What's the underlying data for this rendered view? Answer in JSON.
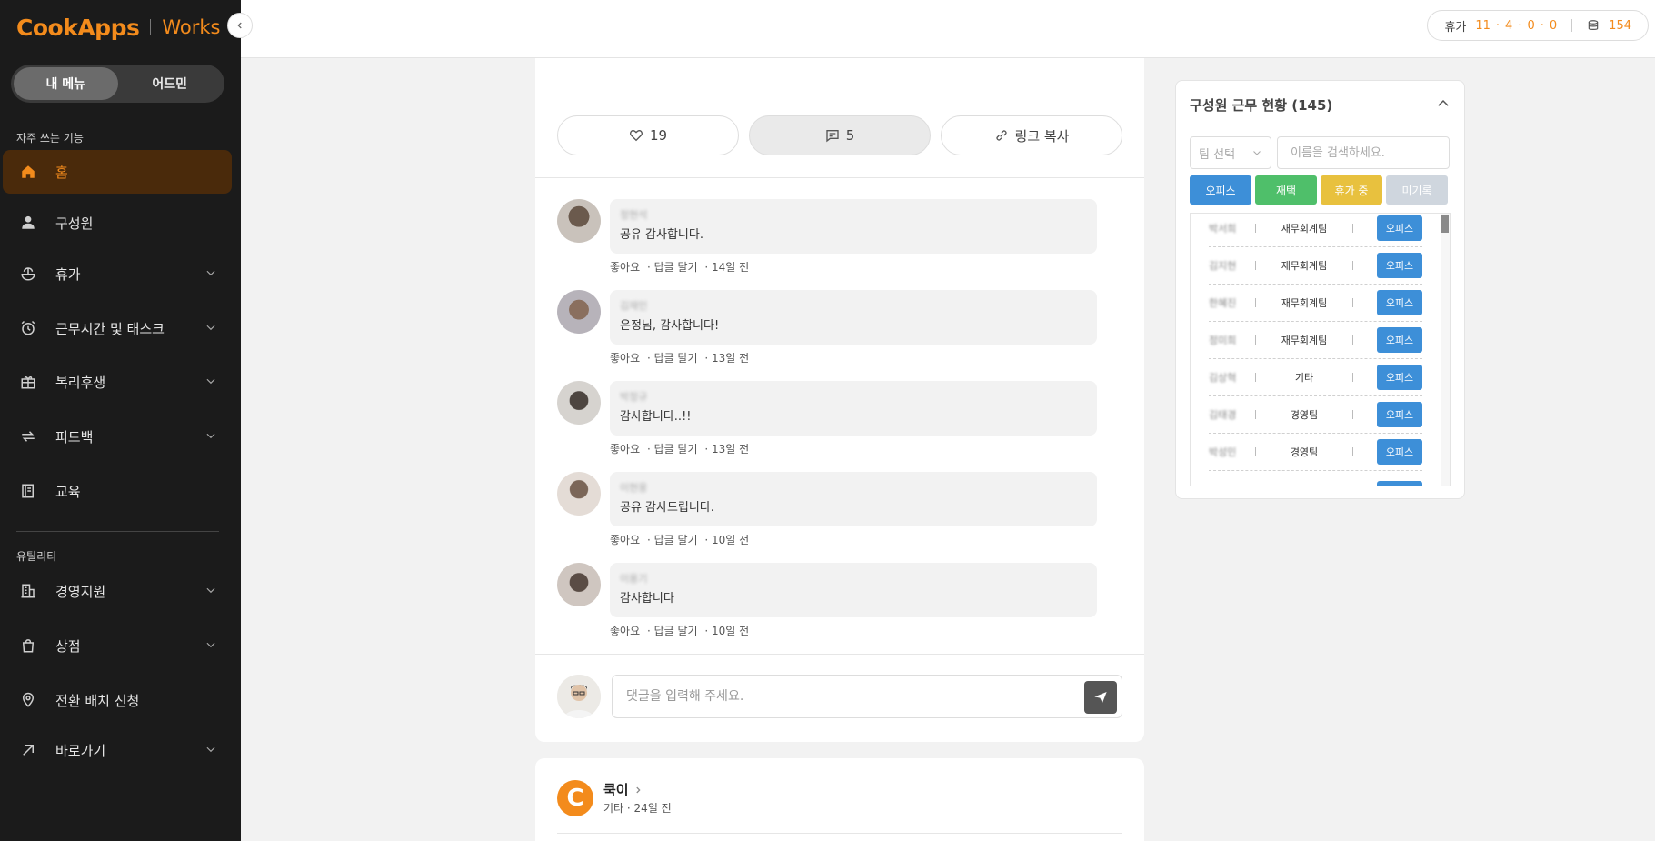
{
  "brand": {
    "name": "CookApps",
    "product": "Works"
  },
  "sidebar": {
    "tabs": [
      {
        "label": "내 메뉴"
      },
      {
        "label": "어드민"
      }
    ],
    "section_frequent": "자주 쓰는 기능",
    "section_utility": "유틸리티",
    "items": [
      {
        "label": "홈",
        "icon": "home-icon"
      },
      {
        "label": "구성원",
        "icon": "person-icon"
      },
      {
        "label": "휴가",
        "icon": "vacation-icon"
      },
      {
        "label": "근무시간 및 태스크",
        "icon": "alarm-icon"
      },
      {
        "label": "복리후생",
        "icon": "gift-icon"
      },
      {
        "label": "피드백",
        "icon": "exchange-icon"
      },
      {
        "label": "교육",
        "icon": "book-icon"
      },
      {
        "label": "경영지원",
        "icon": "building-icon"
      },
      {
        "label": "상점",
        "icon": "bag-icon"
      },
      {
        "label": "전환 배치 신청",
        "icon": "location-icon"
      },
      {
        "label": "바로가기",
        "icon": "arrow-up-right-icon"
      }
    ]
  },
  "topbar": {
    "vacation_label": "휴가",
    "vacation_counts": [
      "11",
      "4",
      "0",
      "0"
    ],
    "points": "154"
  },
  "post": {
    "likes": "19",
    "comments_count": "5",
    "copy_link": "링크 복사",
    "comments": [
      {
        "name": "정현석",
        "text": "공유 감사합니다.",
        "time": "14일 전"
      },
      {
        "name": "김재민",
        "text": "은정님, 감사합니다!",
        "time": "13일 전"
      },
      {
        "name": "박정규",
        "text": "감사합니다..!!",
        "time": "13일 전"
      },
      {
        "name": "이현웅",
        "text": "공유 감사드립니다.",
        "time": "10일 전"
      },
      {
        "name": "이용기",
        "text": "감사합니다",
        "time": "10일 전"
      }
    ],
    "like_label": "좋아요",
    "reply_label": "답글 달기",
    "input_placeholder": "댓글을 입력해 주세요."
  },
  "next_post": {
    "initial": "C",
    "author": "쿡이",
    "category": "기타",
    "time": "24일 전"
  },
  "panel": {
    "title": "구성원 근무 현황 (145)",
    "team_select": "팀 선택",
    "search_placeholder": "이름을 검색하세요.",
    "filters": [
      {
        "label": "오피스",
        "color": "#3d8fd8"
      },
      {
        "label": "재택",
        "color": "#4fbf6a"
      },
      {
        "label": "휴가 중",
        "color": "#e8c13e"
      },
      {
        "label": "미기록",
        "color": "#cfd6de"
      }
    ],
    "members": [
      {
        "name": "박서희",
        "team": "재무회계팀",
        "status": "오피스"
      },
      {
        "name": "김지현",
        "team": "재무회계팀",
        "status": "오피스"
      },
      {
        "name": "한혜진",
        "team": "재무회계팀",
        "status": "오피스"
      },
      {
        "name": "정미희",
        "team": "재무회계팀",
        "status": "오피스"
      },
      {
        "name": "김상혁",
        "team": "기타",
        "status": "오피스"
      },
      {
        "name": "김태경",
        "team": "경영팀",
        "status": "오피스"
      },
      {
        "name": "박성민",
        "team": "경영팀",
        "status": "오피스"
      }
    ]
  }
}
